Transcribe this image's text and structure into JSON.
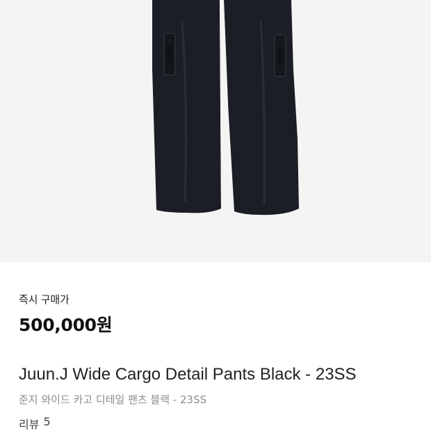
{
  "product": {
    "image_alt": "black wide cargo pants",
    "image_bg": "#f4f4f4",
    "pants_color": "#1b1e24"
  },
  "pricing": {
    "label": "즉시 구매가",
    "price": "500,000원"
  },
  "title": {
    "english": "Juun.J Wide Cargo Detail Pants Black - 23SS",
    "korean": "준지 와이드 카고 디테일 팬츠 블랙 - 23SS"
  },
  "review": {
    "label": "리뷰",
    "count": "5"
  }
}
